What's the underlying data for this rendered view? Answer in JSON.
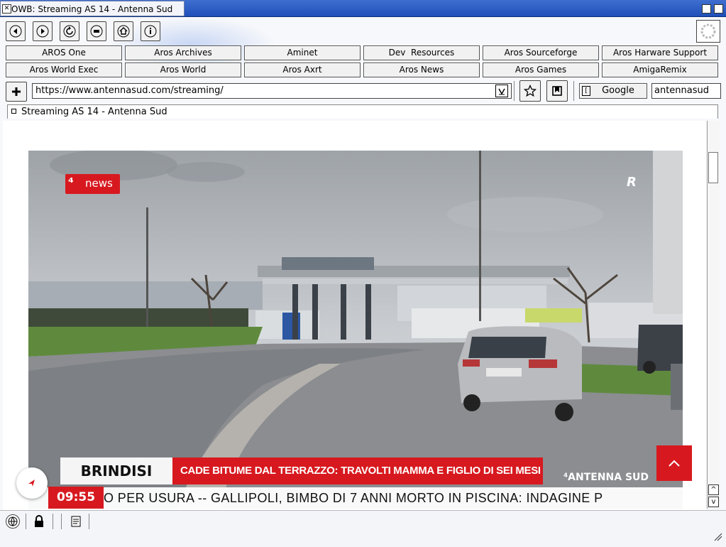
{
  "window": {
    "title": "OWB: Streaming AS 14 - Antenna Sud"
  },
  "nav_buttons": [
    {
      "name": "back-button",
      "icon": "arrow-left-icon"
    },
    {
      "name": "forward-button",
      "icon": "arrow-right-icon"
    },
    {
      "name": "reload-button",
      "icon": "reload-icon"
    },
    {
      "name": "stop-button",
      "icon": "stop-icon"
    },
    {
      "name": "home-button",
      "icon": "home-icon"
    },
    {
      "name": "info-button",
      "icon": "info-icon"
    }
  ],
  "bookmarks_row1": [
    "AROS One",
    "Aros Archives",
    "Aminet",
    "Dev  Resources",
    "Aros Sourceforge",
    "Aros Harware Support"
  ],
  "bookmarks_row2": [
    "Aros World Exec",
    "Aros World",
    "Aros Axrt",
    "Aros News",
    "Aros Games",
    "AmigaRemix"
  ],
  "address": {
    "url": "https://www.antennasud.com/streaming/"
  },
  "search": {
    "engine": "Google",
    "query": "antennasud"
  },
  "tab": {
    "label": "Streaming AS 14 - Antenna Sud"
  },
  "video": {
    "logo_text": "news",
    "watermark": "R",
    "location": "BRINDISI",
    "headline": "CADE BITUME DAL TERRAZZO: TRAVOLTI MAMMA E FIGLIO DI SEI MESI",
    "brand": "ANTENNA SUD",
    "clock": "09:55",
    "ticker": "O PER USURA -- GALLIPOLI, BIMBO DI 7 ANNI MORTO IN PISCINA: INDAGINE P"
  },
  "colors": {
    "accent_red": "#d7191f",
    "title_blue": "#2a5cc4"
  }
}
